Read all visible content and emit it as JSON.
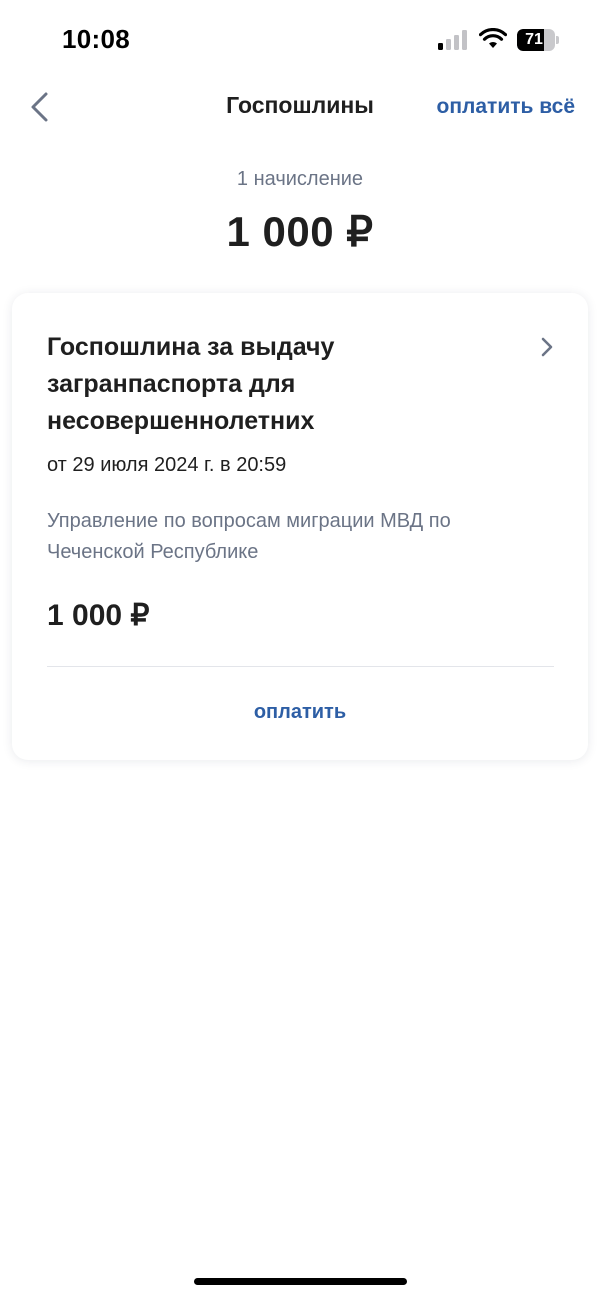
{
  "status_bar": {
    "time": "10:08",
    "battery_level": "71",
    "battery_fraction": 0.71,
    "signal_bars_active": 1,
    "signal_bars_total": 4,
    "icons": [
      "cellular-signal-icon",
      "wifi-icon",
      "battery-icon"
    ]
  },
  "header": {
    "back_icon": "chevron-left-icon",
    "title": "Госпошлины",
    "pay_all_label": "оплатить всё"
  },
  "summary": {
    "count_text": "1 начисление",
    "total": "1 000 ₽"
  },
  "charges": [
    {
      "title": "Госпошлина за выдачу загранпаспорта для несовершеннолетних",
      "date": "от 29 июля 2024 г. в 20:59",
      "organization": "Управление по вопросам миграции МВД по Чеченской Республике",
      "amount": "1 000 ₽",
      "pay_label": "оплатить",
      "chevron_icon": "chevron-right-icon"
    }
  ],
  "colors": {
    "accent": "#2d5ea5",
    "text_primary": "#1f1f1f",
    "text_secondary": "#6b7486",
    "divider": "#e3e5ea",
    "background": "#ffffff"
  }
}
